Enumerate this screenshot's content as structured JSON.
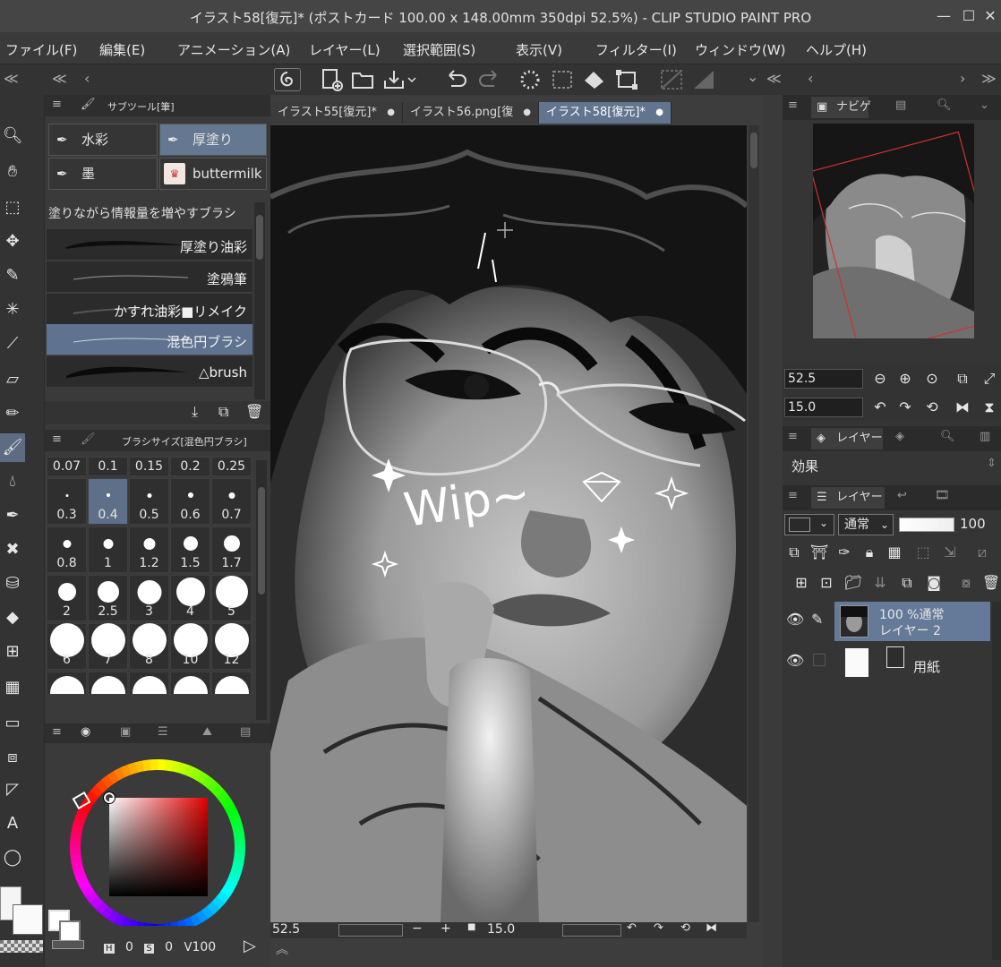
{
  "app": {
    "title": "イラスト58[復元]* (ポストカード 100.00 x 148.00mm 350dpi 52.5%)  - CLIP STUDIO PAINT PRO"
  },
  "menu": [
    "ファイル(F)",
    "編集(E)",
    "アニメーション(A)",
    "レイヤー(L)",
    "選択範囲(S)",
    "表示(V)",
    "フィルター(I)",
    "ウィンドウ(W)",
    "ヘルプ(H)"
  ],
  "subtool": {
    "title": "サブツール[筆]",
    "tabs": [
      "水彩",
      "厚塗り",
      "墨",
      "buttermilk"
    ],
    "active_tab": "厚塗り",
    "header_text": "塗りながら情報量を増やすブラシ",
    "brushes": [
      "厚塗り油彩",
      "塗鴉筆",
      "かすれ油彩■リメイク",
      "混色円ブラシ",
      "△brush"
    ],
    "active_brush": "混色円ブラシ"
  },
  "brush_size": {
    "title": "ブラシサイズ[混色円ブラシ]",
    "top_labels": [
      "0.07",
      "0.1",
      "0.15",
      "0.2",
      "0.25"
    ],
    "rows": [
      [
        "0.3",
        "0.4",
        "0.5",
        "0.6",
        "0.7"
      ],
      [
        "0.8",
        "1",
        "1.2",
        "1.5",
        "1.7"
      ],
      [
        "2",
        "2.5",
        "3",
        "4",
        "5"
      ],
      [
        "6",
        "7",
        "8",
        "10",
        "12"
      ]
    ],
    "selected": "0.4"
  },
  "color": {
    "h": "0",
    "s": "0",
    "v": "100",
    "h_label": "H",
    "s_label": "S",
    "v_label": "V"
  },
  "documents": {
    "tabs": [
      "イラスト55[復元]*",
      "イラスト56.png[復",
      "イラスト58[復元]*"
    ],
    "active": "イラスト58[復元]*"
  },
  "canvas": {
    "annotation": "Wip~"
  },
  "statusbar": {
    "zoom": "52.5",
    "angle": "15.0"
  },
  "navigator": {
    "title": "ナビゲ",
    "zoom": "52.5",
    "angle": "15.0"
  },
  "layer_props": {
    "title": "レイヤー",
    "effect_label": "効果"
  },
  "layers": {
    "title": "レイヤー",
    "blend_mode": "通常",
    "opacity": "100",
    "items": [
      {
        "opacity_mode": "100 %通常",
        "name": "レイヤー 2"
      },
      {
        "name": "用紙"
      }
    ]
  }
}
